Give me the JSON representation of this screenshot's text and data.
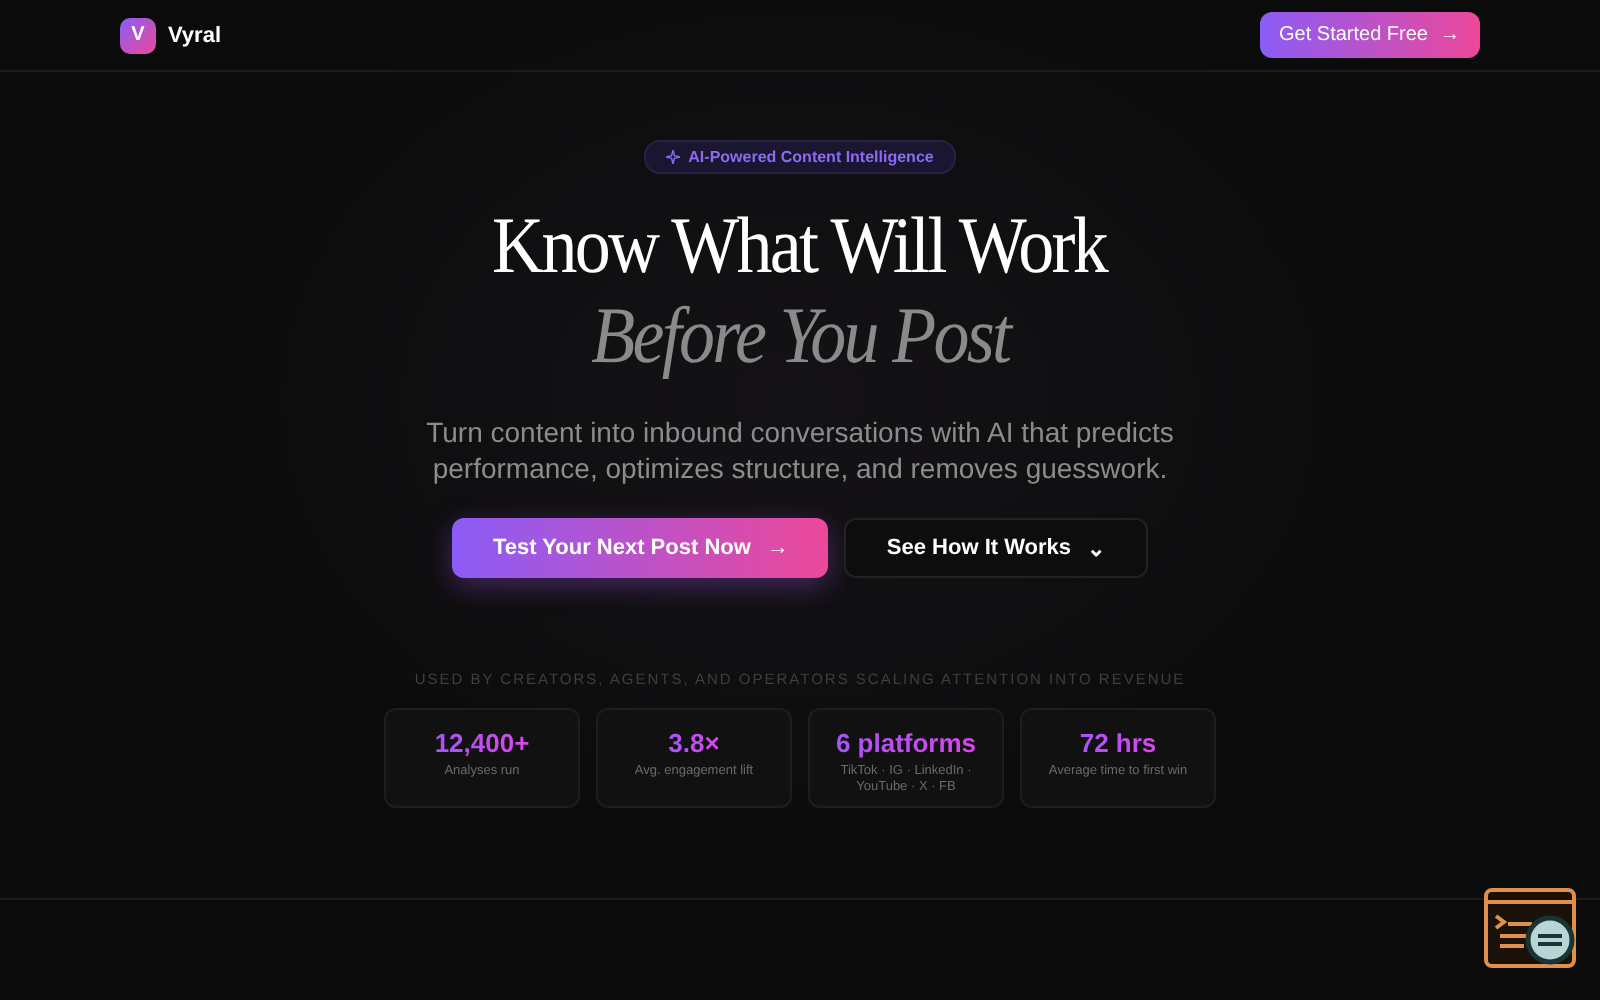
{
  "brand": {
    "logo": "V",
    "name": "Vyral"
  },
  "header_button": {
    "label": "Get Started Free",
    "icon": "→"
  },
  "badge": {
    "label": "AI-Powered Content Intelligence"
  },
  "headline": {
    "line_1": "Know What Will Work",
    "line_2": "Before You Post"
  },
  "subtitle": "Turn content into inbound conversations with AI that predicts performance, optimizes structure, and removes guesswork.",
  "buttons": [
    {
      "kind": "primary",
      "label": "Test Your Next Post Now",
      "icon": "→"
    },
    {
      "kind": "secondary",
      "label": "See How It Works",
      "icon": "⌄"
    }
  ],
  "tagline": "USED BY CREATORS, AGENTS, AND OPERATORS SCALING ATTENTION INTO REVENUE",
  "stats": [
    {
      "value": "12,400+",
      "label": "Analyses run"
    },
    {
      "value": "3.8×",
      "label": "Avg. engagement lift"
    },
    {
      "value": "6 platforms",
      "label": "TikTok · IG · LinkedIn · YouTube · X · FB"
    },
    {
      "value": "72 hrs",
      "label": "Average time to first win"
    }
  ]
}
